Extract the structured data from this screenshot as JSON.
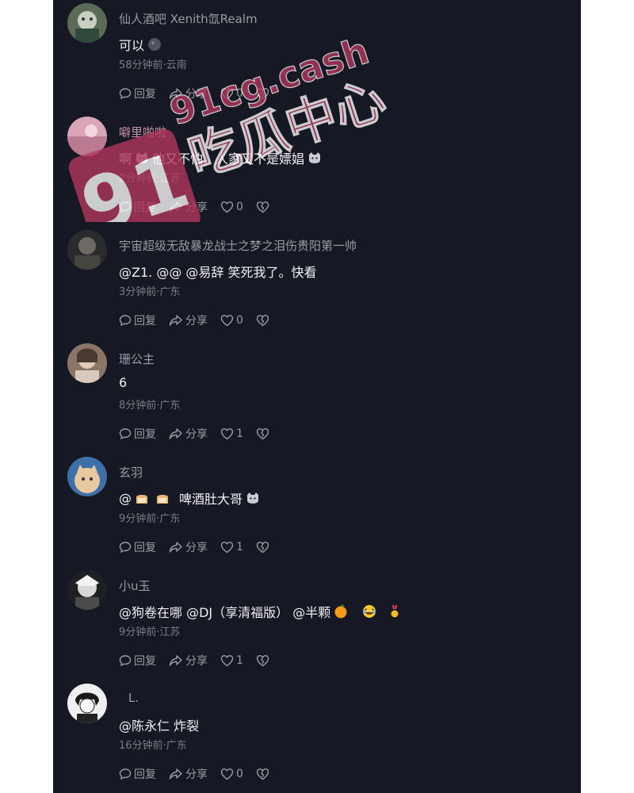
{
  "actions": {
    "reply": "回复",
    "share": "分享"
  },
  "watermark": {
    "brand": "91",
    "site": "91cg.cash",
    "name": "吃瓜中心"
  },
  "comments": [
    {
      "user": "仙人酒吧 Xenith氙Realm",
      "text": "可以",
      "emoji_after": "black-circle-emoji",
      "meta": "58分钟前·云南",
      "likes": "0"
    },
    {
      "user": "噼里啪啦",
      "text_a": "啊",
      "text_b": "他又不怕，人家又不是嫖娼",
      "emoji": "cat-emoji",
      "meta": "2分钟前·江苏",
      "likes": "0"
    },
    {
      "user": "宇宙超级无敌暴龙战士之梦之泪伤贵阳第一帅",
      "text": "@Z1.  @@  @易辞  笑死我了。快看",
      "meta": "3分钟前·广东",
      "likes": "0"
    },
    {
      "user": "珊公主",
      "text": "6",
      "meta": "8分钟前·广东",
      "likes": "1"
    },
    {
      "user": "玄羽",
      "text_a": "@",
      "text_b": "啤酒肚大哥",
      "emoji": "bread-emoji",
      "emoji_end": "cat-emoji",
      "meta": "9分钟前·广东",
      "likes": "1"
    },
    {
      "user": "小u玉",
      "text_a": "@狗卷在哪  @DJ（享清福版）  @半颗",
      "emojis": [
        "orange-emoji",
        "laughing-tears-emoji",
        "medal-emoji"
      ],
      "meta": "9分钟前·江苏",
      "likes": "1"
    },
    {
      "user": "L.",
      "text": "@陈永仁  炸裂",
      "meta": "16分钟前·广东",
      "likes": "0"
    }
  ],
  "colors": {
    "background": "#161823",
    "text": "#f0f0f2",
    "muted": "#7b7c83",
    "watermark": "#b5375f"
  }
}
